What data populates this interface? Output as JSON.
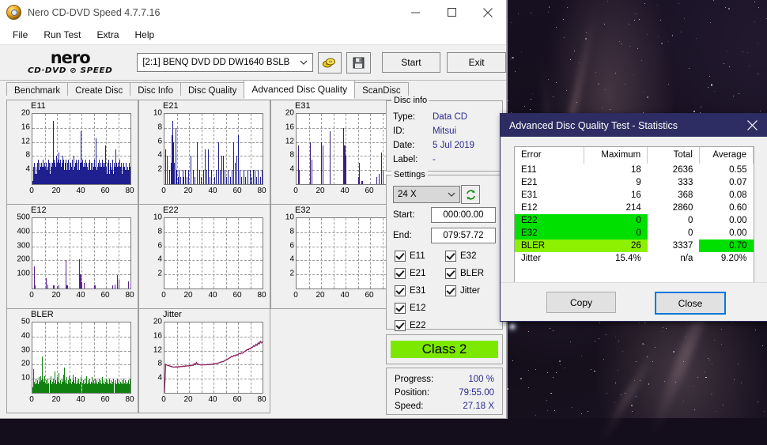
{
  "window": {
    "title": "Nero CD-DVD Speed 4.7.7.16",
    "icon": "nero-disc-icon",
    "controls": {
      "minimize": "minimize-icon",
      "maximize": "maximize-icon",
      "close": "close-icon"
    }
  },
  "menu": {
    "items": [
      "File",
      "Run Test",
      "Extra",
      "Help"
    ]
  },
  "toolbar": {
    "logo_line1": "nero",
    "logo_line2": "CD·DVD ⊘ SPEED",
    "drive": "[2:1]   BENQ DVD DD DW1640 BSLB",
    "speed_icon": "disc-speed-icon",
    "save_icon": "floppy-save-icon",
    "start_label": "Start",
    "exit_label": "Exit"
  },
  "tabs": {
    "items": [
      "Benchmark",
      "Create Disc",
      "Disc Info",
      "Disc Quality",
      "Advanced Disc Quality",
      "ScanDisc"
    ],
    "active": "Advanced Disc Quality"
  },
  "disc_info": {
    "legend": "Disc info",
    "rows": [
      {
        "label": "Type:",
        "value": "Data CD"
      },
      {
        "label": "ID:",
        "value": "Mitsui"
      },
      {
        "label": "Date:",
        "value": "5 Jul 2019"
      },
      {
        "label": "Label:",
        "value": "-"
      }
    ]
  },
  "settings": {
    "legend": "Settings",
    "speed": "24 X",
    "refresh_icon": "refresh-icon",
    "start_label": "Start:",
    "start_value": "000:00.00",
    "end_label": "End:",
    "end_value": "079:57.72",
    "checkboxes": [
      {
        "label": "E11",
        "checked": true
      },
      {
        "label": "E21",
        "checked": true
      },
      {
        "label": "E31",
        "checked": true
      },
      {
        "label": "E12",
        "checked": true
      },
      {
        "label": "E22",
        "checked": true
      },
      {
        "label": "E32",
        "checked": true
      },
      {
        "label": "BLER",
        "checked": true
      },
      {
        "label": "Jitter",
        "checked": true
      }
    ]
  },
  "class_result": {
    "label": "Class 2",
    "color": "#7ce800"
  },
  "progress": {
    "rows": [
      {
        "label": "Progress:",
        "value": "100 %"
      },
      {
        "label": "Position:",
        "value": "79:55.00"
      },
      {
        "label": "Speed:",
        "value": "27.18 X"
      }
    ]
  },
  "statistics_dialog": {
    "title": "Advanced Disc Quality Test - Statistics",
    "close_icon": "close-icon",
    "headers": [
      "Error",
      "Maximum",
      "Total",
      "Average"
    ],
    "rows": [
      {
        "error": "E11",
        "maximum": "18",
        "total": "2636",
        "average": "0.55",
        "highlight": "none"
      },
      {
        "error": "E21",
        "maximum": "9",
        "total": "333",
        "average": "0.07",
        "highlight": "none"
      },
      {
        "error": "E31",
        "maximum": "16",
        "total": "368",
        "average": "0.08",
        "highlight": "none"
      },
      {
        "error": "E12",
        "maximum": "214",
        "total": "2860",
        "average": "0.60",
        "highlight": "none"
      },
      {
        "error": "E22",
        "maximum": "0",
        "total": "0",
        "average": "0.00",
        "highlight": "green-left"
      },
      {
        "error": "E32",
        "maximum": "0",
        "total": "0",
        "average": "0.00",
        "highlight": "green-left"
      },
      {
        "error": "BLER",
        "maximum": "26",
        "total": "3337",
        "average": "0.70",
        "highlight": "lime-left-green-avg"
      },
      {
        "error": "Jitter",
        "maximum": "15.4%",
        "total": "n/a",
        "average": "9.20%",
        "highlight": "none"
      }
    ],
    "copy_label": "Copy",
    "close_label": "Close",
    "highlight_green": "#00e000",
    "highlight_lime": "#8cf000"
  },
  "chart_data": [
    {
      "type": "bar",
      "title": "E11",
      "ylim": [
        0,
        20
      ],
      "xlim": [
        0,
        80
      ],
      "yticks": [
        4,
        8,
        12,
        16,
        20
      ],
      "xticks": [
        0,
        20,
        40,
        60,
        80
      ],
      "color": "#1f1f8f",
      "grid": true,
      "xlabel": "",
      "ylabel": "",
      "values": [
        1,
        3,
        5,
        4,
        6,
        3,
        5,
        4,
        3,
        6,
        4,
        5,
        7,
        4,
        6,
        3,
        5,
        4,
        6,
        5,
        4,
        7,
        5,
        4,
        6,
        3,
        5,
        4,
        6,
        4,
        3,
        5,
        7,
        4,
        6,
        5,
        3,
        4,
        6,
        5,
        4,
        6,
        18,
        5,
        7,
        4,
        6,
        3,
        5,
        8,
        6,
        4,
        7,
        5,
        9,
        6,
        4,
        7,
        5,
        3,
        6,
        4,
        8,
        5,
        7,
        4,
        6,
        3,
        5,
        7,
        4,
        6,
        5,
        3,
        7,
        4,
        6,
        5,
        4,
        6,
        5,
        3,
        7,
        4,
        6,
        8,
        5,
        4,
        6,
        7,
        5,
        3,
        6,
        4,
        7,
        5,
        4,
        6,
        3,
        5,
        15,
        6,
        4,
        7,
        5,
        3,
        6,
        4,
        5,
        7,
        4,
        6,
        3,
        5,
        4,
        6,
        5,
        3,
        7,
        4,
        6,
        5,
        4,
        3,
        6,
        5,
        4,
        7,
        3,
        5,
        13,
        6,
        4,
        5,
        3,
        6,
        4,
        7,
        5,
        3,
        6,
        4,
        5,
        7,
        3,
        6,
        4,
        5,
        3,
        6,
        11,
        4,
        5,
        3,
        6,
        4,
        7,
        5,
        3,
        4,
        6,
        5,
        3,
        4,
        7,
        5,
        3,
        6,
        4,
        5,
        3,
        10,
        6,
        4,
        5,
        3,
        6,
        4,
        5,
        7,
        3,
        5,
        4,
        6,
        3,
        5,
        4,
        6,
        3,
        5,
        4,
        3,
        6,
        5,
        4,
        3,
        5,
        4,
        6,
        3,
        5,
        4
      ]
    },
    {
      "type": "bar",
      "title": "E21",
      "ylim": [
        0,
        10
      ],
      "xlim": [
        0,
        80
      ],
      "yticks": [
        2,
        4,
        6,
        8,
        10
      ],
      "xticks": [
        0,
        20,
        40,
        60,
        80
      ],
      "color": "#1f1f8f",
      "grid": true,
      "values": [
        0,
        5,
        0,
        4,
        0,
        0,
        2,
        0,
        3,
        7,
        9,
        6,
        3,
        0,
        8,
        2,
        0,
        1,
        2,
        0,
        1,
        0,
        2,
        1,
        0,
        2,
        0,
        1,
        0,
        2,
        0,
        0,
        4,
        0,
        0,
        2,
        0,
        1,
        0,
        0,
        6,
        0,
        0,
        2,
        0,
        1,
        0,
        0,
        2,
        0,
        5,
        0,
        2,
        0,
        5,
        0,
        1,
        0,
        2,
        0,
        0,
        1,
        0,
        2,
        0,
        0,
        6,
        0,
        2,
        0,
        4,
        0,
        4,
        0,
        2,
        0,
        1,
        0,
        2,
        0,
        0,
        1,
        0,
        2,
        0,
        6,
        0,
        3,
        0,
        4,
        0,
        7,
        0,
        2,
        0,
        1,
        0,
        0,
        2,
        0,
        1,
        0,
        2,
        0,
        0,
        2,
        0,
        1,
        0,
        2,
        0,
        2,
        0,
        1,
        0,
        2,
        0,
        0,
        1,
        0,
        2
      ]
    },
    {
      "type": "bar",
      "title": "E31",
      "ylim": [
        0,
        20
      ],
      "xlim": [
        0,
        80
      ],
      "yticks": [
        4,
        8,
        12,
        16,
        20
      ],
      "xticks": [
        0,
        20,
        40,
        60,
        80
      ],
      "color": "#3b1f7a",
      "grid": true,
      "values": [
        0,
        11,
        4,
        0,
        0,
        0,
        0,
        0,
        0,
        0,
        0,
        12,
        7,
        0,
        0,
        0,
        0,
        0,
        0,
        0,
        12,
        11,
        0,
        0,
        0,
        0,
        0,
        15,
        0,
        0,
        0,
        0,
        0,
        0,
        0,
        0,
        0,
        0,
        16,
        11,
        8,
        0,
        0,
        0,
        0,
        0,
        0,
        0,
        0,
        0,
        2,
        6,
        0,
        1,
        0,
        0,
        0,
        0,
        0,
        0,
        0,
        0,
        0,
        0,
        0,
        2,
        0,
        3,
        0,
        9,
        4,
        0,
        0,
        0,
        0,
        0,
        0,
        0,
        7,
        0
      ]
    },
    {
      "type": "bar",
      "title": "E12",
      "ylim": [
        0,
        500
      ],
      "xlim": [
        0,
        80
      ],
      "yticks": [
        100,
        200,
        300,
        400,
        500
      ],
      "xticks": [
        0,
        20,
        40,
        60,
        80
      ],
      "color": "#5b1f8f",
      "grid": true,
      "values": [
        0,
        160,
        20,
        0,
        0,
        0,
        0,
        0,
        0,
        0,
        0,
        75,
        30,
        0,
        0,
        0,
        0,
        20,
        0,
        0,
        15,
        20,
        0,
        0,
        0,
        0,
        0,
        205,
        25,
        0,
        0,
        0,
        0,
        0,
        0,
        0,
        0,
        0,
        210,
        100,
        45,
        0,
        40,
        0,
        0,
        0,
        0,
        0,
        0,
        0,
        25,
        20,
        0,
        0,
        0,
        0,
        0,
        0,
        0,
        0,
        0,
        0,
        0,
        0,
        0,
        20,
        0,
        30,
        0,
        95,
        60,
        0,
        0,
        0,
        0,
        0,
        0,
        0,
        50,
        0
      ]
    },
    {
      "type": "bar",
      "title": "E22",
      "ylim": [
        0,
        10
      ],
      "xlim": [
        0,
        80
      ],
      "yticks": [
        2,
        4,
        6,
        8,
        10
      ],
      "xticks": [
        0,
        20,
        40,
        60,
        80
      ],
      "color": "#1f1f8f",
      "grid": true,
      "values": []
    },
    {
      "type": "bar",
      "title": "E32",
      "ylim": [
        0,
        10
      ],
      "xlim": [
        0,
        80
      ],
      "yticks": [
        2,
        4,
        6,
        8,
        10
      ],
      "xticks": [
        0,
        20,
        40,
        60,
        80
      ],
      "color": "#1f1f8f",
      "grid": true,
      "values": []
    },
    {
      "type": "bar",
      "title": "BLER",
      "ylim": [
        0,
        50
      ],
      "xlim": [
        0,
        80
      ],
      "yticks": [
        10,
        20,
        30,
        40,
        50
      ],
      "xticks": [
        0,
        20,
        40,
        60,
        80
      ],
      "color": "#108010",
      "grid": true,
      "values": [
        4,
        17,
        8,
        6,
        10,
        7,
        9,
        6,
        11,
        8,
        12,
        9,
        26,
        10,
        8,
        12,
        7,
        9,
        6,
        10,
        7,
        9,
        12,
        6,
        8,
        10,
        7,
        15,
        9,
        6,
        11,
        8,
        14,
        7,
        9,
        6,
        10,
        8,
        13,
        18,
        9,
        7,
        11,
        6,
        9,
        12,
        7,
        10,
        6,
        8,
        13,
        9,
        7,
        11,
        6,
        9,
        7,
        10,
        6,
        8,
        11,
        7,
        9,
        6,
        10,
        7,
        12,
        6,
        9,
        7,
        10,
        6,
        8,
        11,
        7,
        9,
        6,
        10,
        7,
        9,
        6,
        8,
        10,
        7,
        9,
        6,
        11,
        7,
        9,
        6,
        8,
        10,
        7,
        9,
        6,
        10,
        7,
        9,
        6,
        8,
        10,
        7,
        9,
        6,
        10,
        7,
        9,
        6,
        8,
        7,
        9,
        6,
        10,
        7,
        9,
        6,
        8,
        7,
        9,
        6,
        10
      ]
    },
    {
      "type": "line",
      "title": "Jitter",
      "ylim": [
        0,
        20
      ],
      "xlim": [
        0,
        80
      ],
      "yticks": [
        4,
        8,
        12,
        16,
        20
      ],
      "xticks": [
        0,
        20,
        40,
        60,
        80
      ],
      "color": "#8b1a5a",
      "grid": true,
      "values": [
        0,
        8.1,
        7.9,
        7.8,
        7.7,
        7.6,
        7.5,
        7.4,
        7.35,
        7.3,
        7.35,
        7.4,
        7.3,
        7.45,
        7.4,
        7.5,
        7.45,
        7.6,
        7.5,
        7.65,
        7.6,
        7.7,
        7.65,
        7.8,
        7.7,
        7.9,
        7.8,
        8.3,
        8.0,
        8.6,
        8.2,
        8.1,
        8.0,
        7.95,
        7.9,
        7.95,
        8.0,
        7.95,
        8.0,
        8.05,
        8.0,
        8.1,
        8.05,
        8.2,
        8.15,
        8.3,
        8.25,
        8.4,
        8.35,
        8.5,
        8.6,
        8.7,
        8.8,
        8.9,
        9.0,
        9.2,
        9.4,
        9.5,
        9.7,
        9.9,
        10.1,
        10.4,
        10.3,
        10.6,
        10.5,
        10.8,
        10.7,
        11.0,
        11.2,
        11.1,
        11.4,
        11.3,
        11.6,
        11.8,
        12.0,
        12.3,
        12.2,
        12.6,
        12.5,
        12.9,
        13.0,
        13.4,
        13.2,
        13.8,
        13.5,
        14.2,
        13.9,
        14.6,
        14.2,
        14.5
      ]
    }
  ]
}
